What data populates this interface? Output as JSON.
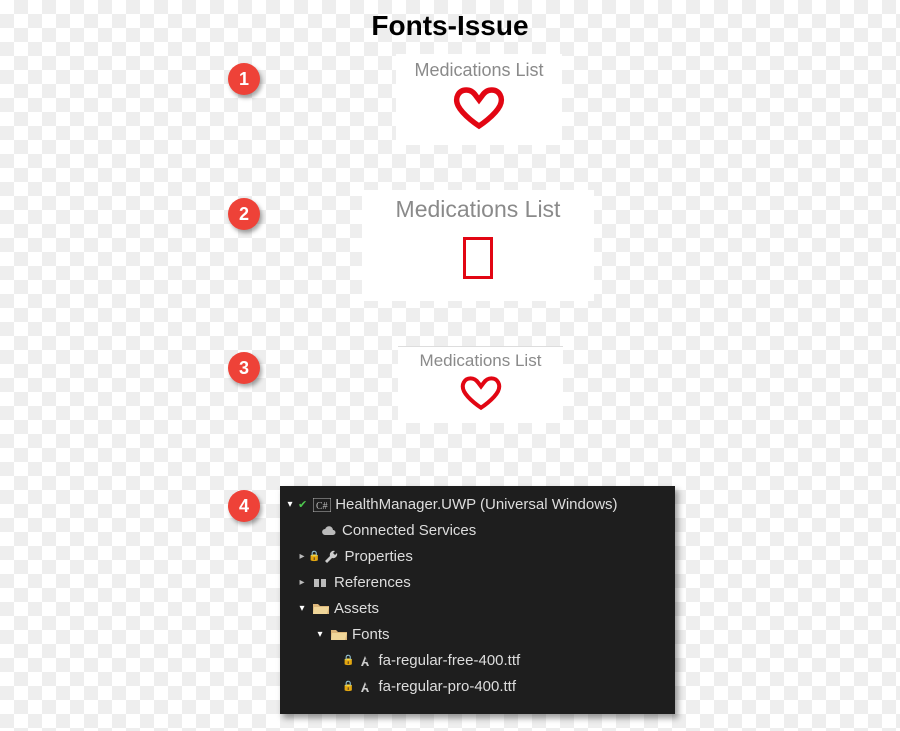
{
  "title": "Fonts-Issue",
  "badges": [
    "1",
    "2",
    "3",
    "4"
  ],
  "card_label": "Medications List",
  "solution_explorer": {
    "project": "HealthManager.UWP (Universal Windows)",
    "nodes": {
      "connected_services": "Connected Services",
      "properties": "Properties",
      "references": "References",
      "assets": "Assets",
      "fonts": "Fonts",
      "file1": "fa-regular-free-400.ttf",
      "file2": "fa-regular-pro-400.ttf"
    }
  }
}
